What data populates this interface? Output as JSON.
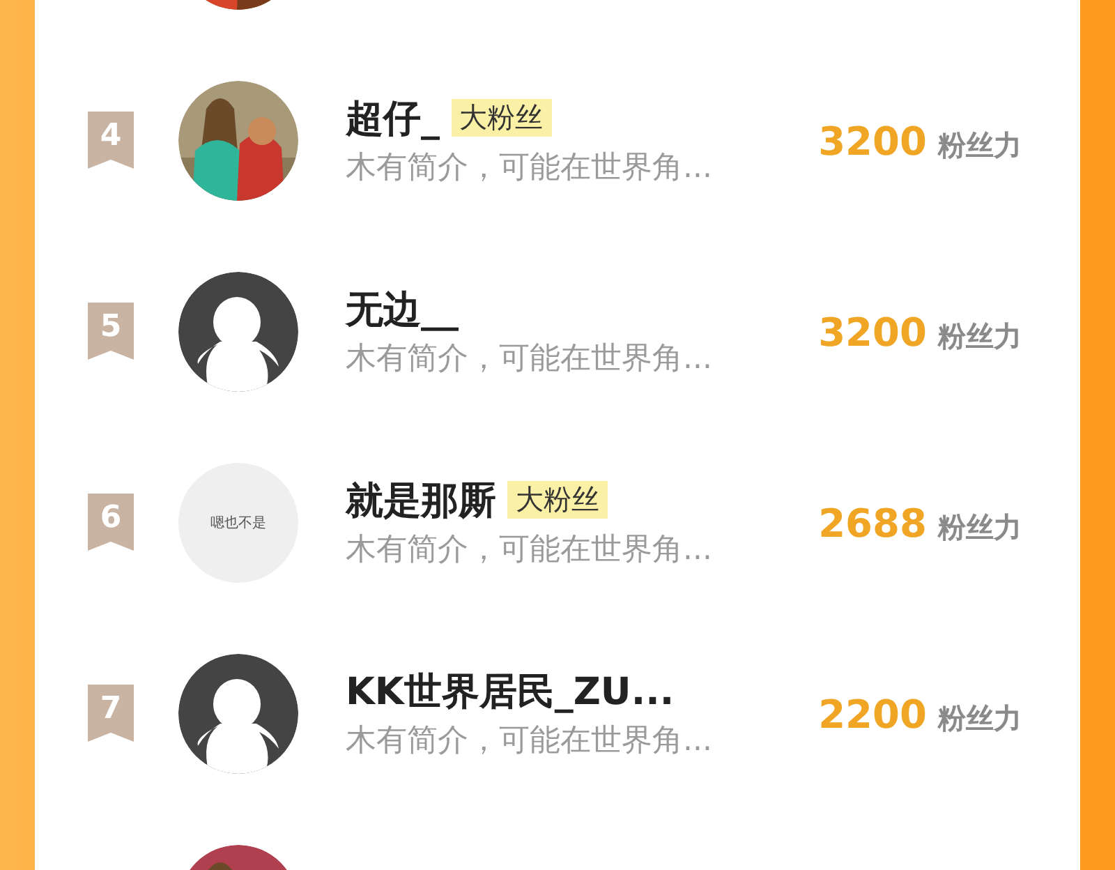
{
  "rows": [
    {
      "avatar": {
        "kind": "picture"
      }
    },
    {
      "rank": "4",
      "avatar": {
        "kind": "picture"
      },
      "name": "超仔_",
      "tag": "大粉丝",
      "bio": "木有简介，可能在世界角...",
      "score": "3200",
      "unit": "粉丝力"
    },
    {
      "rank": "5",
      "avatar": {
        "kind": "default"
      },
      "name": "无边__",
      "bio": "木有简介，可能在世界角...",
      "score": "3200",
      "unit": "粉丝力"
    },
    {
      "rank": "6",
      "avatar": {
        "kind": "text",
        "text": "嗯也不是"
      },
      "name": "就是那厮",
      "tag": "大粉丝",
      "bio": "木有简介，可能在世界角...",
      "score": "2688",
      "unit": "粉丝力"
    },
    {
      "rank": "7",
      "avatar": {
        "kind": "default"
      },
      "name": "KK世界居民_ZU...",
      "bio": "木有简介，可能在世界角...",
      "score": "2200",
      "unit": "粉丝力"
    },
    {
      "avatar": {
        "kind": "picture"
      }
    }
  ]
}
